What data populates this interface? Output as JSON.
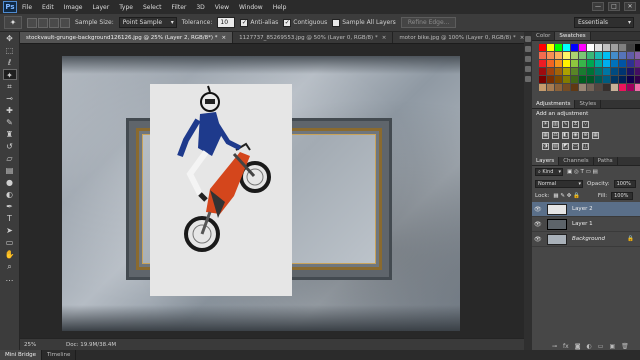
{
  "app": {
    "logo": "Ps"
  },
  "menu": [
    "File",
    "Edit",
    "Image",
    "Layer",
    "Type",
    "Select",
    "Filter",
    "3D",
    "View",
    "Window",
    "Help"
  ],
  "window_controls": [
    "—",
    "□",
    "✕"
  ],
  "options": {
    "sample_size_label": "Sample Size:",
    "sample_size_value": "Point Sample",
    "tolerance_label": "Tolerance:",
    "tolerance_value": "10",
    "antialias_label": "Anti-alias",
    "contiguous_label": "Contiguous",
    "sample_all_label": "Sample All Layers",
    "refine_edge_label": "Refine Edge...",
    "workspace_value": "Essentials"
  },
  "tabs": [
    {
      "label": "stockvault-grunge-background126126.jpg @ 25% (Layer 2, RGB/8*) *",
      "close": "×"
    },
    {
      "label": "1127737_85269553.jpg @ 50% (Layer 0, RGB/8) *",
      "close": "×"
    },
    {
      "label": "motor bike.jpg @ 100% (Layer 0, RGB/8) *",
      "close": "×"
    }
  ],
  "status": {
    "zoom": "25%",
    "doc": "Doc: 19.9M/38.4M"
  },
  "bottom_tabs": [
    "Mini Bridge",
    "Timeline"
  ],
  "panels": {
    "color_tabs": [
      "Color",
      "Swatches"
    ],
    "adjust_tabs": [
      "Adjustments",
      "Styles"
    ],
    "adjust_title": "Add an adjustment",
    "layers_tabs": [
      "Layers",
      "Channels",
      "Paths"
    ],
    "kind_label": "Kind",
    "blend_mode": "Normal",
    "opacity_label": "Opacity:",
    "opacity_value": "100%",
    "lock_label": "Lock:",
    "fill_label": "Fill:",
    "fill_value": "100%",
    "layers": [
      {
        "name": "Layer 2"
      },
      {
        "name": "Layer 1"
      },
      {
        "name": "Background"
      }
    ]
  },
  "colors": {
    "swatches": [
      "#ff0000",
      "#ffff00",
      "#00ff00",
      "#00ffff",
      "#0000ff",
      "#ff00ff",
      "#ffffff",
      "#e0e0e0",
      "#c0c0c0",
      "#a0a0a0",
      "#808080",
      "#404040",
      "#000000",
      "#f26c4f",
      "#f68e55",
      "#fbaf5c",
      "#fff467",
      "#acd372",
      "#7cc576",
      "#3bb878",
      "#1abbb4",
      "#00bff3",
      "#438cca",
      "#5574b9",
      "#605ca8",
      "#855fa8",
      "#ed1c24",
      "#f26522",
      "#f7941d",
      "#fff200",
      "#8dc73f",
      "#39b54a",
      "#00a651",
      "#00a99d",
      "#00aeef",
      "#0072bc",
      "#0054a6",
      "#2e3192",
      "#662d91",
      "#9e0b0f",
      "#a0410d",
      "#a36209",
      "#aba000",
      "#598527",
      "#1a7b30",
      "#007236",
      "#00746b",
      "#0076a3",
      "#004b80",
      "#003471",
      "#1b1464",
      "#440e62",
      "#790000",
      "#7b2e00",
      "#7d4900",
      "#827b00",
      "#406618",
      "#005e20",
      "#005826",
      "#005952",
      "#005b7f",
      "#003663",
      "#002157",
      "#0d004c",
      "#32004b",
      "#c69c6d",
      "#a67c52",
      "#8c6239",
      "#754c24",
      "#603913",
      "#998675",
      "#736357",
      "#534741",
      "#362f2d",
      "#c7b299",
      "#ed145b",
      "#9e005d",
      "#f06eaa"
    ]
  }
}
